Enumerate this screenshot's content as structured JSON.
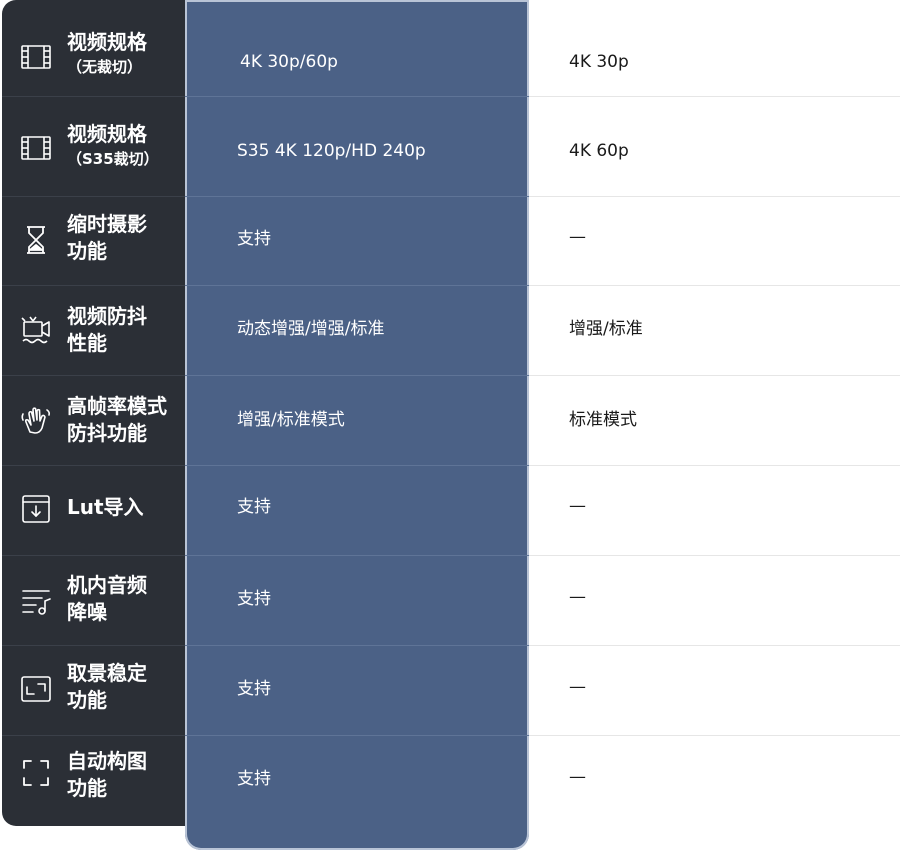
{
  "rows": [
    {
      "icon": "film-strip-icon",
      "label_line1": "视频规格",
      "label_line2": "（无裁切）",
      "col1": "4K 30p/60p",
      "col2": "4K 30p"
    },
    {
      "icon": "film-strip-icon",
      "label_line1": "视频规格",
      "label_line2": "（S35裁切）",
      "col1": "S35 4K 120p/HD 240p",
      "col2": "4K 60p"
    },
    {
      "icon": "hourglass-icon",
      "label_line1": "缩时摄影",
      "label_line2": "功能",
      "col1": "支持",
      "col2": "—"
    },
    {
      "icon": "stabilized-camera-icon",
      "label_line1": "视频防抖",
      "label_line2": "性能",
      "col1": "动态增强/增强/标准",
      "col2": "增强/标准"
    },
    {
      "icon": "shaking-hand-icon",
      "label_line1": "高帧率模式",
      "label_line2": "防抖功能",
      "col1": "增强/标准模式",
      "col2": "标准模式"
    },
    {
      "icon": "import-box-icon",
      "label_line1": "Lut导入",
      "label_line2": "",
      "col1": "支持",
      "col2": "—"
    },
    {
      "icon": "audio-list-icon",
      "label_line1": "机内音频",
      "label_line2": "降噪",
      "col1": "支持",
      "col2": "—"
    },
    {
      "icon": "frame-expand-icon",
      "label_line1": "取景稳定",
      "label_line2": "功能",
      "col1": "支持",
      "col2": "—"
    },
    {
      "icon": "auto-frame-icon",
      "label_line1": "自动构图",
      "label_line2": "功能",
      "col1": "支持",
      "col2": "—"
    }
  ],
  "colors": {
    "left_bg": "#2b2f36",
    "mid_bg": "#4b6186",
    "right_bg": "#ffffff",
    "mid_text": "#ffffff",
    "right_text": "#1a1a1a"
  }
}
